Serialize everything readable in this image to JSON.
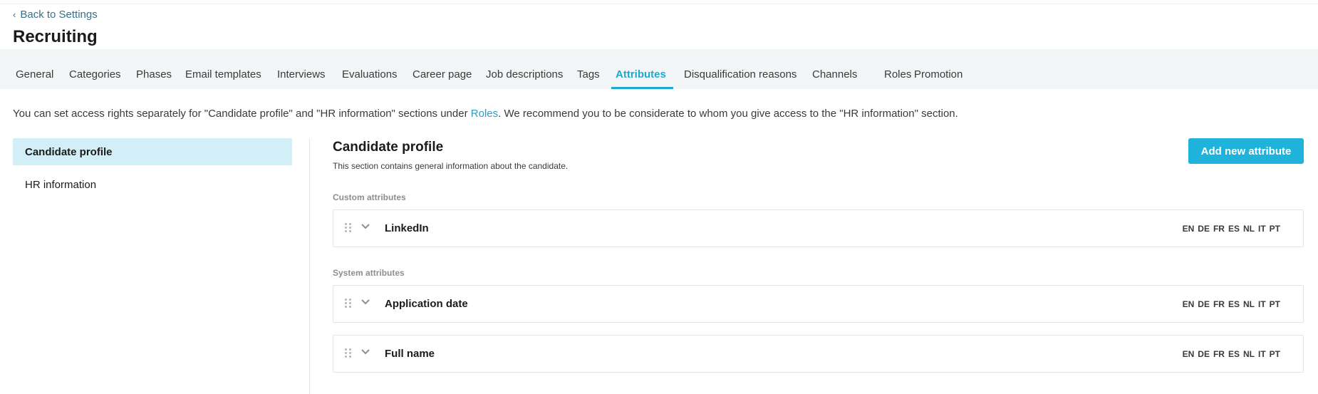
{
  "nav": {
    "back_label": "Back to Settings"
  },
  "page": {
    "title": "Recruiting"
  },
  "tabs": [
    {
      "label": "General"
    },
    {
      "label": "Categories"
    },
    {
      "label": "Phases"
    },
    {
      "label": "Email templates"
    },
    {
      "label": "Interviews"
    },
    {
      "label": "Evaluations"
    },
    {
      "label": "Career page"
    },
    {
      "label": "Job descriptions"
    },
    {
      "label": "Tags"
    },
    {
      "label": "Attributes",
      "active": true
    },
    {
      "label": "Disqualification reasons"
    },
    {
      "label": "Channels"
    },
    {
      "label": "Roles"
    },
    {
      "label": "Promotion"
    }
  ],
  "info": {
    "text_before": "You can set access rights separately for \"Candidate profile\" and \"HR information\" sections under ",
    "link": "Roles",
    "text_after": ". We recommend you to be considerate to whom you give access to the \"HR information\" section."
  },
  "sidebar": {
    "items": [
      {
        "label": "Candidate profile",
        "active": true
      },
      {
        "label": "HR information"
      }
    ]
  },
  "section": {
    "title": "Candidate profile",
    "description": "This section contains general information about the candidate.",
    "add_button": "Add new attribute",
    "custom_label": "Custom attributes",
    "system_label": "System attributes"
  },
  "languages": [
    "EN",
    "DE",
    "FR",
    "ES",
    "NL",
    "IT",
    "PT"
  ],
  "attributes": {
    "custom": [
      {
        "name": "LinkedIn"
      }
    ],
    "system": [
      {
        "name": "Application date"
      },
      {
        "name": "Full name"
      }
    ]
  },
  "colors": {
    "accent": "#1fa9cc",
    "button": "#1fb3dc",
    "selected_bg": "#d2eef7",
    "tabs_bg": "#f3f6f7"
  }
}
